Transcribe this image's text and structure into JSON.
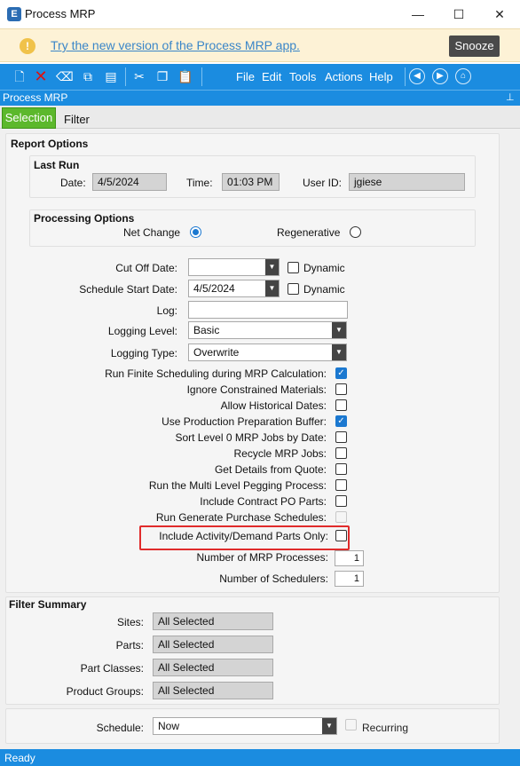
{
  "window": {
    "title": "Process MRP",
    "app_icon": "E",
    "controls": [
      "minimize-icon",
      "maximize-icon",
      "close-icon"
    ]
  },
  "banner": {
    "link_text": "Try the new version of the Process MRP app.",
    "snooze_label": "Snooze",
    "icon": "warning-icon"
  },
  "toolbar": {
    "menus": [
      "File",
      "Edit",
      "Tools",
      "Actions",
      "Help"
    ]
  },
  "panel": {
    "title": "Process MRP"
  },
  "tabs": [
    {
      "label": "Selection",
      "active": true
    },
    {
      "label": "Filter",
      "active": false
    }
  ],
  "report_options": {
    "title": "Report Options",
    "last_run": {
      "title": "Last Run",
      "date_label": "Date:",
      "date_value": "4/5/2024",
      "time_label": "Time:",
      "time_value": "01:03 PM",
      "user_label": "User ID:",
      "user_value": "jgiese"
    },
    "processing": {
      "title": "Processing Options",
      "net_change_label": "Net Change",
      "regenerative_label": "Regenerative",
      "selected": "Net Change"
    },
    "cutoff": {
      "label": "Cut Off Date:",
      "value": "",
      "dynamic_label": "Dynamic"
    },
    "schedule_start": {
      "label": "Schedule Start Date:",
      "value": "4/5/2024",
      "dynamic_label": "Dynamic"
    },
    "log": {
      "label": "Log:",
      "value": ""
    },
    "logging_level": {
      "label": "Logging Level:",
      "value": "Basic"
    },
    "logging_type": {
      "label": "Logging Type:",
      "value": "Overwrite"
    },
    "checkboxes": [
      {
        "label": "Run Finite Scheduling during MRP Calculation:",
        "checked": true
      },
      {
        "label": "Ignore Constrained Materials:",
        "checked": false
      },
      {
        "label": "Allow Historical Dates:",
        "checked": false
      },
      {
        "label": "Use Production Preparation Buffer:",
        "checked": true
      },
      {
        "label": "Sort Level 0 MRP Jobs by Date:",
        "checked": false
      },
      {
        "label": "Recycle MRP Jobs:",
        "checked": false
      },
      {
        "label": "Get Details from Quote:",
        "checked": false
      },
      {
        "label": "Run the Multi Level Pegging Process:",
        "checked": false
      },
      {
        "label": "Include Contract PO Parts:",
        "checked": false
      },
      {
        "label": "Run Generate Purchase Schedules:",
        "checked": false,
        "disabled": true
      },
      {
        "label": "Include Activity/Demand Parts Only:",
        "checked": false
      }
    ],
    "num_processes": {
      "label": "Number of MRP Processes:",
      "value": "1"
    },
    "num_schedulers": {
      "label": "Number of Schedulers:",
      "value": "1"
    }
  },
  "filter_summary": {
    "title": "Filter Summary",
    "rows": [
      {
        "label": "Sites:",
        "value": "All Selected"
      },
      {
        "label": "Parts:",
        "value": "All Selected"
      },
      {
        "label": "Part Classes:",
        "value": "All Selected"
      },
      {
        "label": "Product Groups:",
        "value": "All Selected"
      }
    ]
  },
  "schedule": {
    "label": "Schedule:",
    "value": "Now",
    "recurring_label": "Recurring"
  },
  "status": {
    "text": "Ready"
  },
  "colors": {
    "accent": "#1b8ce0",
    "tab_active": "#5cb82c",
    "highlight": "#e02b2b"
  }
}
